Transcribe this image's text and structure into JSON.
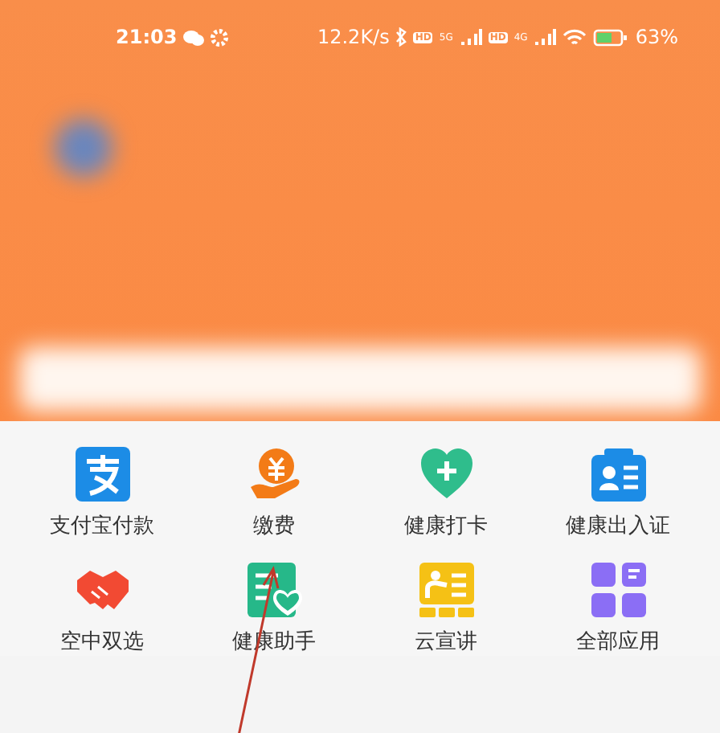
{
  "status_bar": {
    "time": "21:03",
    "speed": "12.2K/s",
    "sim1": {
      "hd": "HD",
      "network": "5G"
    },
    "sim2": {
      "hd": "HD",
      "network": "4G"
    },
    "battery": "63%"
  },
  "apps": [
    {
      "label": "支付宝付款",
      "kind": "alipay"
    },
    {
      "label": "缴费",
      "kind": "payment"
    },
    {
      "label": "健康打卡",
      "kind": "heart"
    },
    {
      "label": "健康出入证",
      "kind": "pass"
    },
    {
      "label": "空中双选",
      "kind": "handshake"
    },
    {
      "label": "健康助手",
      "kind": "assistant"
    },
    {
      "label": "云宣讲",
      "kind": "lecture"
    },
    {
      "label": "全部应用",
      "kind": "grid"
    }
  ]
}
